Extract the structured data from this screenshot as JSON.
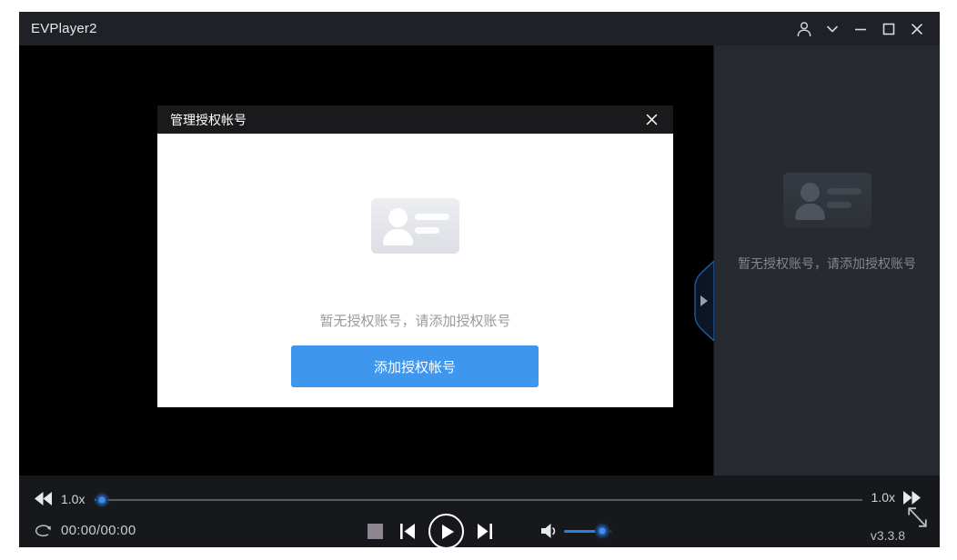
{
  "window": {
    "title": "EVPlayer2"
  },
  "titlebar": {
    "icons": [
      "user-icon",
      "chevron-down-icon",
      "minimize-icon",
      "maximize-icon",
      "close-icon"
    ]
  },
  "modal": {
    "title": "管理授权帐号",
    "empty_text": "暂无授权账号，请添加授权账号",
    "add_button_label": "添加授权帐号",
    "close_icon": "close-x"
  },
  "sidebar": {
    "empty_text": "暂无授权账号，请添加授权账号",
    "collapse_icon": "triangle-right"
  },
  "player": {
    "speed_left": "1.0x",
    "speed_right": "1.0x",
    "time": "00:00/00:00",
    "progress_percent": 1,
    "volume_percent": 79,
    "version": "v3.3.8",
    "icons": [
      "rewind-icon",
      "loop-icon",
      "stop-icon",
      "previous-icon",
      "play-icon",
      "next-icon",
      "volume-icon",
      "fast-forward-icon",
      "expand-icon"
    ]
  },
  "colors": {
    "accent_blue": "#3e96ef",
    "volume_blue": "#2e7ee2",
    "titlebar_bg": "#1f2127",
    "sidebar_bg": "#282a31",
    "bottombar_bg": "#17181c"
  }
}
